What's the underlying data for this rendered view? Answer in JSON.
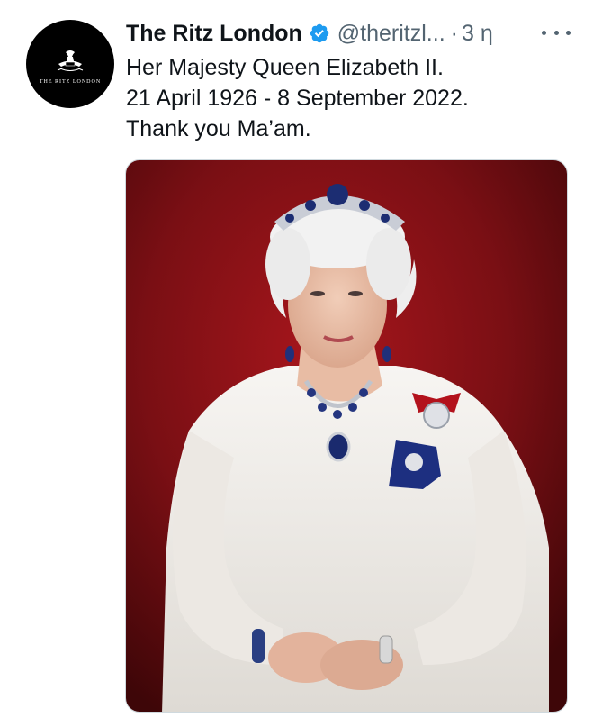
{
  "tweet": {
    "display_name": "The Ritz London",
    "handle": "@theritzl...",
    "separator": "·",
    "time": "3 η",
    "lines": [
      "Her Majesty Queen Elizabeth II.",
      "21 April 1926 - 8 September 2022.",
      "Thank you Ma’am."
    ]
  },
  "avatar": {
    "logo_text": "THE RITZ LONDON",
    "crest_text": "RITZ"
  },
  "icons": {
    "verified": "verified-badge-icon",
    "more": "more-options-icon"
  },
  "colors": {
    "verified_blue": "#1d9bf0",
    "text_primary": "#0f1419",
    "text_secondary": "#536471",
    "photo_background": "#8a1418"
  }
}
